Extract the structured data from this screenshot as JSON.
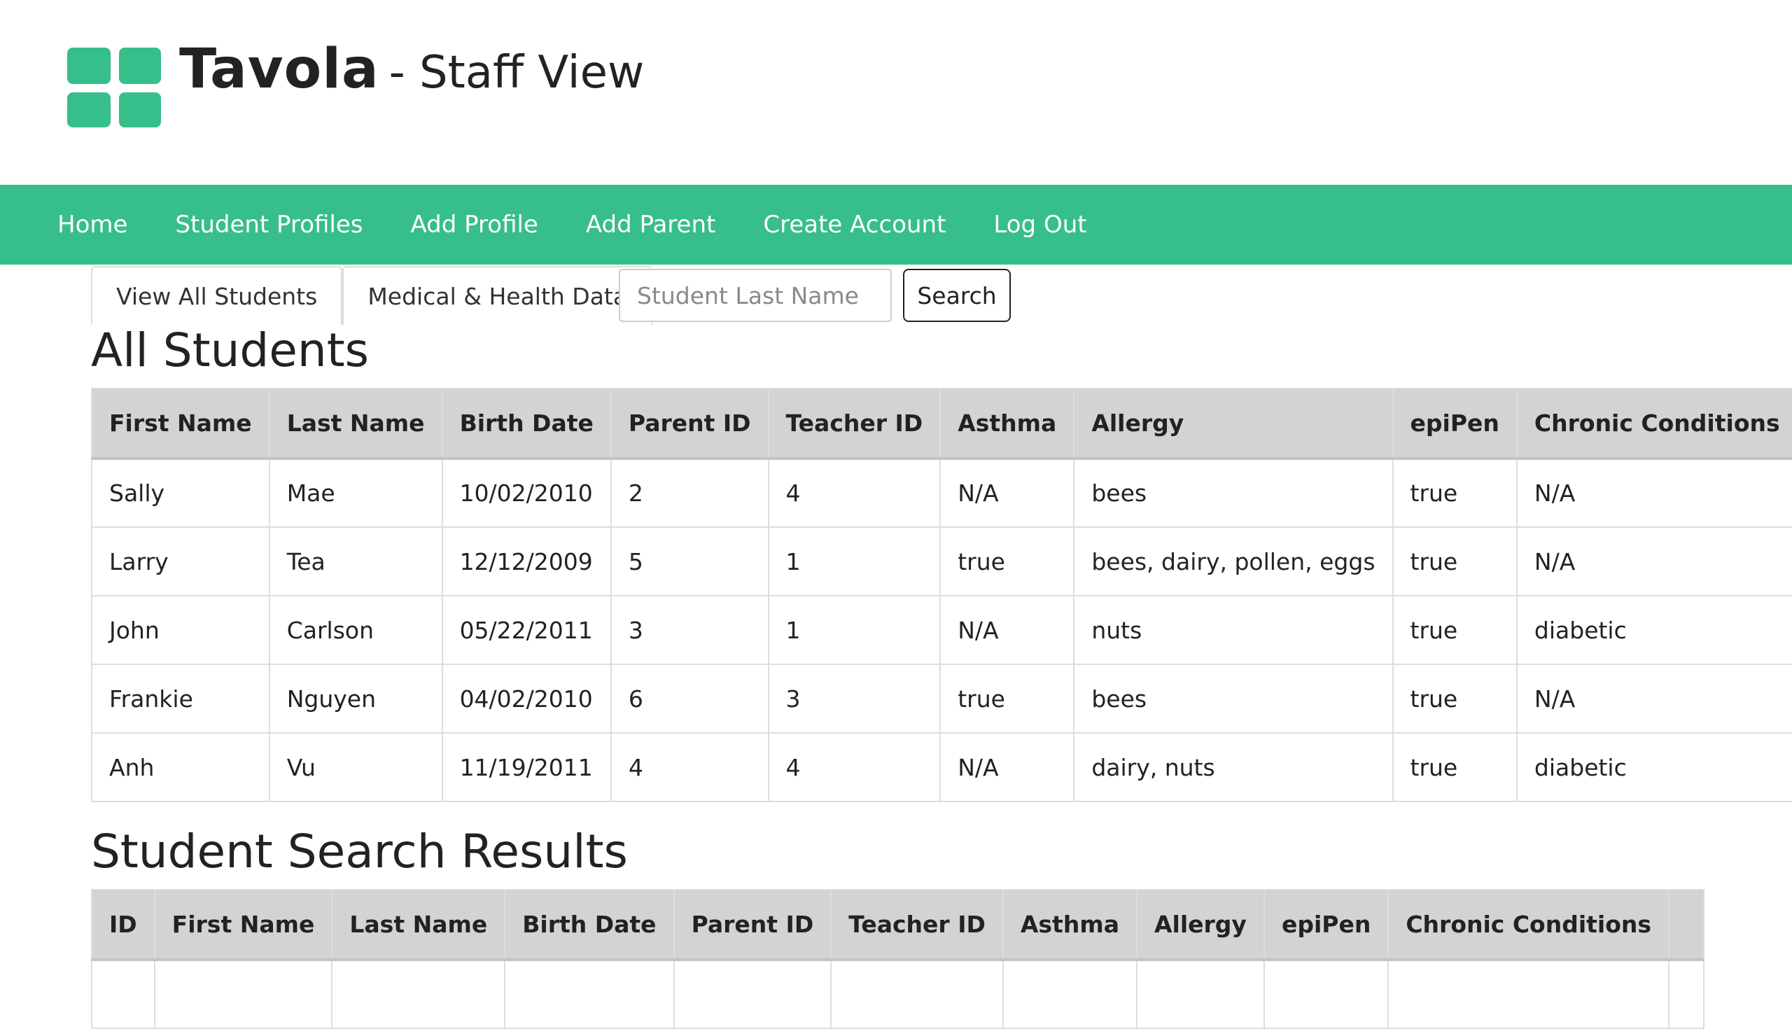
{
  "brand": {
    "name": "Tavola",
    "subtitle": "- Staff View",
    "accent_color": "#36be8b"
  },
  "nav": {
    "items": [
      {
        "label": "Home"
      },
      {
        "label": "Student Profiles"
      },
      {
        "label": "Add Profile"
      },
      {
        "label": "Add Parent"
      },
      {
        "label": "Create Account"
      },
      {
        "label": "Log Out"
      }
    ]
  },
  "tabs": [
    {
      "label": "View All Students"
    },
    {
      "label": "Medical & Health Data"
    }
  ],
  "search": {
    "placeholder": "Student Last Name",
    "value": "",
    "button_label": "Search"
  },
  "all_students": {
    "title": "All Students",
    "columns": [
      "First Name",
      "Last Name",
      "Birth Date",
      "Parent ID",
      "Teacher ID",
      "Asthma",
      "Allergy",
      "epiPen",
      "Chronic Conditions"
    ],
    "rows": [
      [
        "Sally",
        "Mae",
        "10/02/2010",
        "2",
        "4",
        "N/A",
        "bees",
        "true",
        "N/A"
      ],
      [
        "Larry",
        "Tea",
        "12/12/2009",
        "5",
        "1",
        "true",
        "bees, dairy, pollen, eggs",
        "true",
        "N/A"
      ],
      [
        "John",
        "Carlson",
        "05/22/2011",
        "3",
        "1",
        "N/A",
        "nuts",
        "true",
        "diabetic"
      ],
      [
        "Frankie",
        "Nguyen",
        "04/02/2010",
        "6",
        "3",
        "true",
        "bees",
        "true",
        "N/A"
      ],
      [
        "Anh",
        "Vu",
        "11/19/2011",
        "4",
        "4",
        "N/A",
        "dairy, nuts",
        "true",
        "diabetic"
      ]
    ]
  },
  "search_results": {
    "title": "Student Search Results",
    "columns": [
      "ID",
      "First Name",
      "Last Name",
      "Birth Date",
      "Parent ID",
      "Teacher ID",
      "Asthma",
      "Allergy",
      "epiPen",
      "Chronic Conditions",
      ""
    ],
    "rows": [
      [
        "",
        "",
        "",
        "",
        "",
        "",
        "",
        "",
        "",
        "",
        ""
      ]
    ]
  }
}
